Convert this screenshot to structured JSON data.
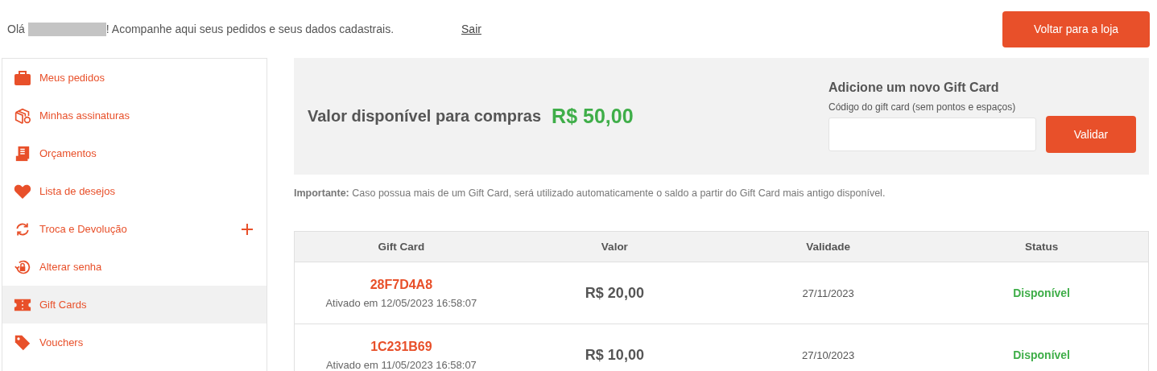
{
  "header": {
    "greeting_start": "Olá",
    "greeting_end": "! Acompanhe aqui seus pedidos e seus dados cadastrais.",
    "logout_link": "Sair",
    "back_button": "Voltar para a loja"
  },
  "sidebar": {
    "items": [
      {
        "kind": "briefcase",
        "label": "Meus pedidos",
        "selected": false
      },
      {
        "kind": "box",
        "label": "Minhas assinaturas",
        "selected": false
      },
      {
        "kind": "receipt",
        "label": "Orçamentos",
        "selected": false
      },
      {
        "kind": "heart",
        "label": "Lista de desejos",
        "selected": false
      },
      {
        "kind": "exchange",
        "label": "Troca e Devolução",
        "selected": false,
        "expandable": true
      },
      {
        "kind": "lock",
        "label": "Alterar senha",
        "selected": false
      },
      {
        "kind": "ticket",
        "label": "Gift Cards",
        "selected": true
      },
      {
        "kind": "tag",
        "label": "Vouchers",
        "selected": false
      }
    ]
  },
  "balance": {
    "label": "Valor disponível para compras",
    "amount": "R$ 50,00"
  },
  "add_gift_card": {
    "title": "Adicione um novo Gift Card",
    "field_label": "Código do gift card (sem pontos e espaços)",
    "button": "Validar"
  },
  "notice": "**Importante:** Caso possua mais de um Gift Card, será utilizado automaticamente o saldo a partir do Gift Card mais antigo disponível.",
  "table": {
    "columns": [
      "Gift Card",
      "Valor",
      "Validade",
      "Status"
    ],
    "rows": [
      {
        "code": "28F7D4A8",
        "activated": "Ativado em 12/05/2023 16:58:07",
        "value": "R$ 20,00",
        "validity": "27/11/2023",
        "status": "Disponível"
      },
      {
        "code": "1C231B69",
        "activated": "Ativado em 11/05/2023 16:58:07",
        "value": "R$ 10,00",
        "validity": "27/10/2023",
        "status": "Disponível"
      }
    ]
  }
}
